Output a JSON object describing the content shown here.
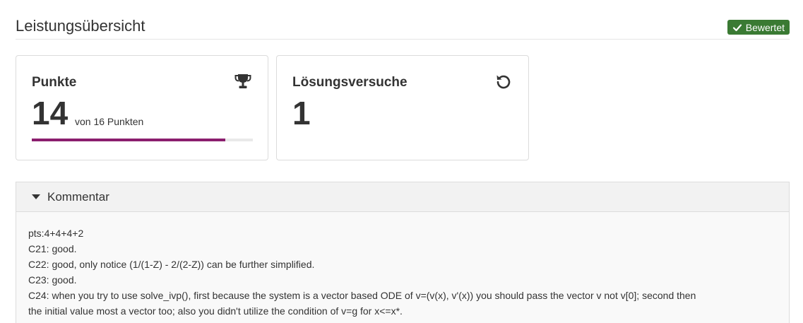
{
  "header": {
    "title": "Leistungsübersicht",
    "badge_label": "Bewertet",
    "badge_color": "#3a7a33"
  },
  "points_card": {
    "title": "Punkte",
    "icon": "trophy-icon",
    "value": "14",
    "subtitle": "von 16 Punkten",
    "progress_fraction": 0.875,
    "progress_color": "#8b1e6e"
  },
  "attempts_card": {
    "title": "Lösungsversuche",
    "icon": "undo-icon",
    "value": "1"
  },
  "comment": {
    "label": "Kommentar",
    "expanded": true,
    "lines": [
      "pts:4+4+4+2",
      "C21: good.",
      "C22: good, only notice (1/(1-Z) - 2/(2-Z)) can be further simplified.",
      "C23: good.",
      "C24: when you try to use solve_ivp(), first because the system is a vector based ODE of v=(v(x), v'(x)) you should pass the vector v not v[0]; second then",
      "the initial value most a vector too; also you didn't utilize the condition of v=g for x<=x*."
    ]
  }
}
